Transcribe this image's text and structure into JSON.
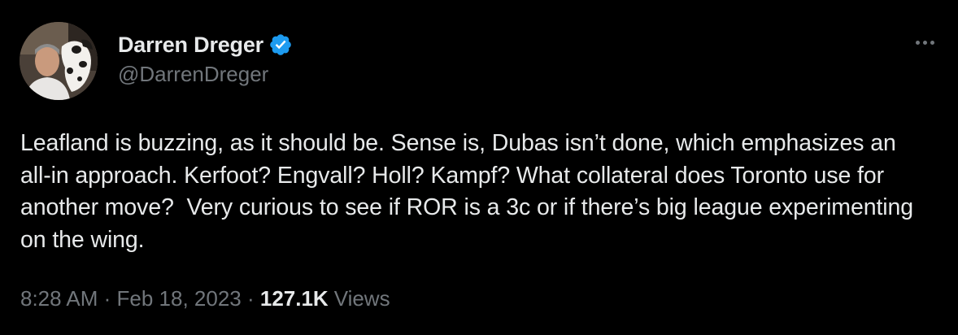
{
  "author": {
    "display_name": "Darren Dreger",
    "handle": "@DarrenDreger",
    "verified": true,
    "verified_color": "#1d9bf0"
  },
  "tweet": {
    "text": "Leafland is buzzing, as it should be. Sense is, Dubas isn’t done, which emphasizes an all-in approach. Kerfoot? Engvall? Holl? Kampf? What collateral does Toronto use for another move?  Very curious to see if ROR is a 3c or if there’s big league experimenting on the wing.",
    "time": "8:28 AM",
    "separator": " · ",
    "date": "Feb 18, 2023",
    "views_count": "127.1K",
    "views_label": "Views"
  },
  "icons": {
    "more": "more-horizontal-icon",
    "verified": "verified-badge-icon"
  },
  "colors": {
    "background": "#000000",
    "primary_text": "#e7e9ea",
    "secondary_text": "#71767b"
  }
}
